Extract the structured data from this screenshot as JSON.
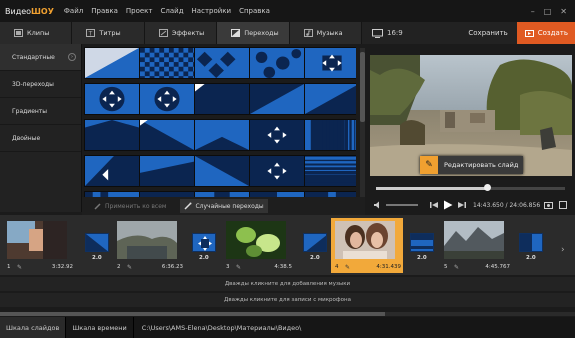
{
  "app": {
    "logo_part1": "Видео",
    "logo_part2": "ШОУ"
  },
  "menu": [
    "Файл",
    "Правка",
    "Проект",
    "Слайд",
    "Настройки",
    "Справка"
  ],
  "window_buttons": [
    "–",
    "□",
    "✕"
  ],
  "tabs": [
    {
      "label": "Клипы",
      "icon": "film-icon"
    },
    {
      "label": "Титры",
      "icon": "text-icon"
    },
    {
      "label": "Эффекты",
      "icon": "effects-icon"
    },
    {
      "label": "Переходы",
      "icon": "transition-icon"
    },
    {
      "label": "Музыка",
      "icon": "music-icon"
    }
  ],
  "active_tab": "Переходы",
  "categories": [
    "Стандартные",
    "3D-переходы",
    "Градиенты",
    "Двойные"
  ],
  "active_category": "Стандартные",
  "transition_actions": {
    "apply_all": "Применить ко всем",
    "random": "Случайные переходы"
  },
  "right_header": {
    "aspect": "16:9",
    "save": "Сохранить",
    "create": "Создать"
  },
  "preview": {
    "edit_slide": "Редактировать слайд",
    "progress": 0.59
  },
  "player": {
    "time": "14:43.650 / 24:06.856"
  },
  "slides": [
    {
      "num": "1",
      "duration": "3:32.92",
      "selected": false
    },
    {
      "num": "2",
      "duration": "6:36.23",
      "selected": false
    },
    {
      "num": "3",
      "duration": "4:38.5",
      "selected": false
    },
    {
      "num": "4",
      "duration": "4:31.439",
      "selected": true
    },
    {
      "num": "5",
      "duration": "4:45.767",
      "selected": false
    }
  ],
  "transitions": [
    "2.0",
    "2.0",
    "2.0",
    "2.0",
    "2.0"
  ],
  "timeline": {
    "music_hint": "Дважды кликните для добавления музыки",
    "mic_hint": "Дважды кликните для записи с микрофона"
  },
  "bottom": {
    "tab_slides": "Шкала слайдов",
    "tab_time": "Шкала времени",
    "path": "C:\\Users\\AMS-Elena\\Desktop\\Материалы\\Видео\\"
  },
  "colors": {
    "accent": "#f0a030",
    "create": "#e05a22",
    "transition_blue": "#1f66c0"
  }
}
